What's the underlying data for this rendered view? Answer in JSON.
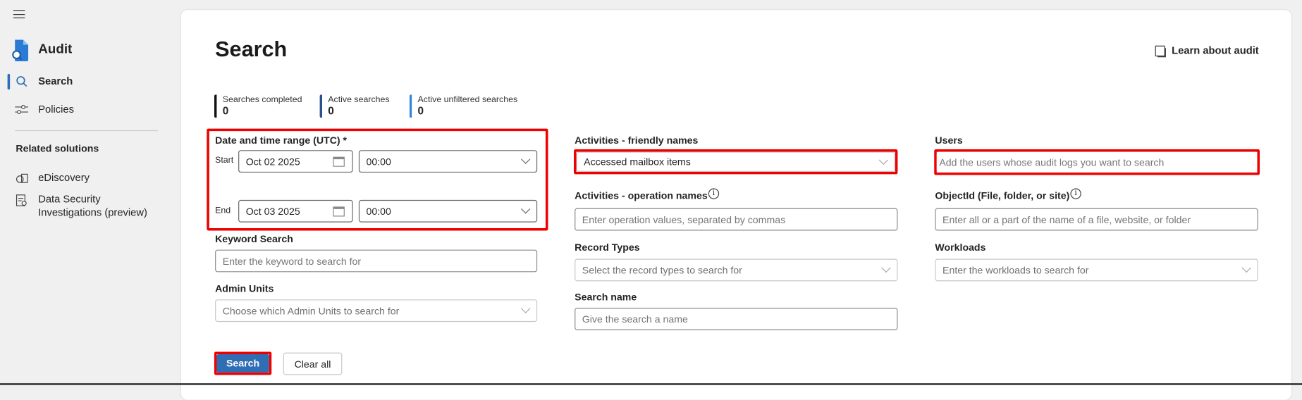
{
  "sidebar": {
    "app_title": "Audit",
    "items": [
      {
        "label": "Search",
        "active": true
      },
      {
        "label": "Policies"
      }
    ],
    "related_heading": "Related solutions",
    "related": [
      {
        "label": "eDiscovery"
      },
      {
        "label": "Data Security Investigations (preview)"
      }
    ]
  },
  "header": {
    "title": "Search",
    "learn_link": "Learn about audit"
  },
  "stats": [
    {
      "label": "Searches completed",
      "value": "0",
      "color": "#111111"
    },
    {
      "label": "Active searches",
      "value": "0",
      "color": "#2b4f8c"
    },
    {
      "label": "Active unfiltered searches",
      "value": "0",
      "color": "#2f86d9"
    }
  ],
  "form": {
    "date_range": {
      "label": "Date and time range (UTC) *",
      "start_label": "Start",
      "start_date": "Oct 02 2025",
      "start_time": "00:00",
      "end_label": "End",
      "end_date": "Oct 03 2025",
      "end_time": "00:00"
    },
    "keyword": {
      "label": "Keyword Search",
      "placeholder": "Enter the keyword to search for"
    },
    "admin_units": {
      "label": "Admin Units",
      "placeholder": "Choose which Admin Units to search for"
    },
    "activities_friendly": {
      "label": "Activities - friendly names",
      "value": "Accessed mailbox items"
    },
    "activities_operation": {
      "label": "Activities - operation names",
      "placeholder": "Enter operation values, separated by commas"
    },
    "record_types": {
      "label": "Record Types",
      "placeholder": "Select the record types to search for"
    },
    "search_name": {
      "label": "Search name",
      "placeholder": "Give the search a name"
    },
    "users": {
      "label": "Users",
      "placeholder": "Add the users whose audit logs you want to search"
    },
    "object_id": {
      "label": "ObjectId (File, folder, or site)",
      "placeholder": "Enter all or a part of the name of a file, website, or folder"
    },
    "workloads": {
      "label": "Workloads",
      "placeholder": "Enter the workloads to search for"
    }
  },
  "buttons": {
    "search": "Search",
    "clear": "Clear all"
  },
  "colors": {
    "primary": "#2f6db5",
    "highlight": "#ee0000"
  }
}
